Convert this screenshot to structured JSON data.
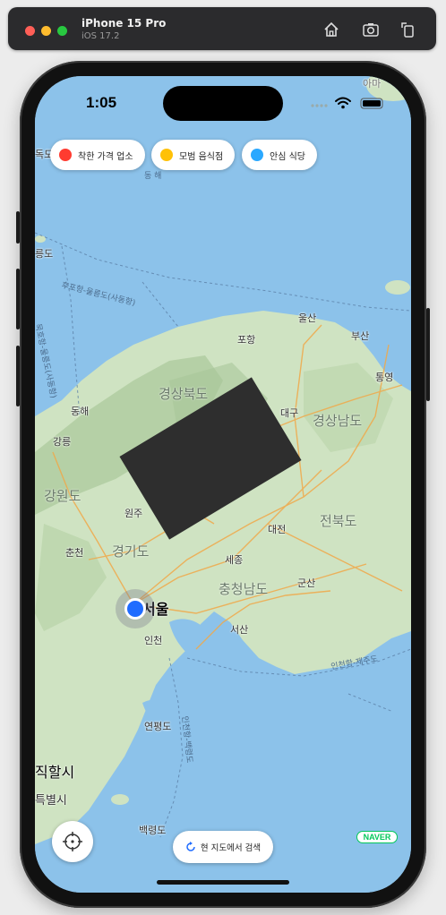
{
  "simulator": {
    "device": "iPhone 15 Pro",
    "os": "iOS 17.2"
  },
  "status": {
    "time": "1:05"
  },
  "filters": [
    {
      "label": "착한 가격 업소",
      "color": "#ff3b30"
    },
    {
      "label": "모범 음식점",
      "color": "#ffc107"
    },
    {
      "label": "안심 식당",
      "color": "#2aa8ff"
    }
  ],
  "map_labels": {
    "ulsan": "울산",
    "pohang": "포항",
    "busan": "부산",
    "tongyeong": "통영",
    "gyeongbuk": "경상북도",
    "gyeongnam": "경상남도",
    "daegu": "대구",
    "donghae": "동해",
    "gangneung": "강릉",
    "gangwon": "강원도",
    "wonju": "원주",
    "chuncheon": "춘천",
    "gyeonggi": "경기도",
    "daejeon": "대전",
    "jeonbuk": "전북도",
    "sejong": "세종",
    "chungnam": "충청남도",
    "gunsan": "군산",
    "seoul": "서울",
    "incheon": "인천",
    "seosan": "서산",
    "yeonpyeong": "연평도",
    "baengnyeong": "백령도",
    "jikhalsi": "직할시",
    "teukbyeolsi": "특별시",
    "route_incheon_jeju": "인천항-제주도",
    "route_incheon_baengnyeong": "인천항-백령도",
    "route_hupo_ulleung": "후포항-울릉도(사동항)",
    "route_mukho_ulleung": "묵호항-울릉도(사동항)",
    "top_right": "아마",
    "east_sea": "동 해",
    "dokdo": "독도",
    "uldo": "릉도"
  },
  "search_here": "현 지도에서 검색",
  "naver_logo": "NAVER"
}
